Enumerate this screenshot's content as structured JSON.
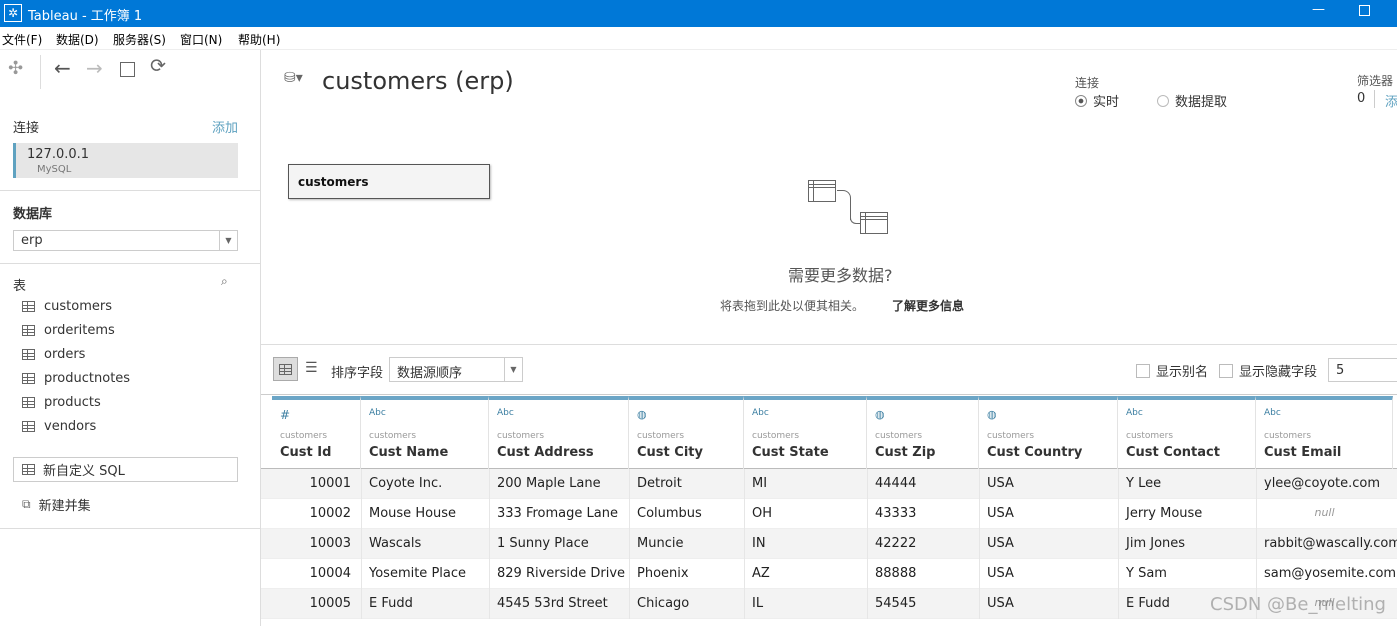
{
  "window": {
    "title": "Tableau - 工作簿 1"
  },
  "menu": [
    "文件(F)",
    "数据(D)",
    "服务器(S)",
    "窗口(N)",
    "帮助(H)"
  ],
  "sidebar": {
    "connections_label": "连接",
    "add_label": "添加",
    "connection": {
      "host": "127.0.0.1",
      "type": "MySQL"
    },
    "database_label": "数据库",
    "database_value": "erp",
    "tables_label": "表",
    "tables": [
      "customers",
      "orderitems",
      "orders",
      "productnotes",
      "products",
      "vendors"
    ],
    "custom_sql": "新自定义 SQL",
    "new_union": "新建并集"
  },
  "header": {
    "title": "customers (erp)",
    "connection_label": "连接",
    "live": "实时",
    "extract": "数据提取",
    "connection_mode": "live",
    "filters_label": "筛选器",
    "filters_count": "0",
    "filters_add": "添"
  },
  "canvas": {
    "table_chip": "customers",
    "need_more": "需要更多数据?",
    "hint": "将表拖到此处以便其相关。",
    "learn_more": "了解更多信息"
  },
  "grid_toolbar": {
    "sort_label": "排序字段",
    "sort_value": "数据源顺序",
    "show_alias": "显示别名",
    "show_hidden": "显示隐藏字段",
    "rows_value": "5"
  },
  "columns": [
    {
      "type": "#",
      "source": "customers",
      "name": "Cust Id"
    },
    {
      "type": "Abc",
      "source": "customers",
      "name": "Cust Name"
    },
    {
      "type": "Abc",
      "source": "customers",
      "name": "Cust Address"
    },
    {
      "type": "globe",
      "source": "customers",
      "name": "Cust City"
    },
    {
      "type": "Abc",
      "source": "customers",
      "name": "Cust State"
    },
    {
      "type": "globe",
      "source": "customers",
      "name": "Cust Zip"
    },
    {
      "type": "globe",
      "source": "customers",
      "name": "Cust Country"
    },
    {
      "type": "Abc",
      "source": "customers",
      "name": "Cust Contact"
    },
    {
      "type": "Abc",
      "source": "customers",
      "name": "Cust Email"
    }
  ],
  "rows": [
    [
      "10001",
      "Coyote Inc.",
      "200 Maple Lane",
      "Detroit",
      "MI",
      "44444",
      "USA",
      "Y Lee",
      "ylee@coyote.com"
    ],
    [
      "10002",
      "Mouse House",
      "333 Fromage Lane",
      "Columbus",
      "OH",
      "43333",
      "USA",
      "Jerry Mouse",
      "null"
    ],
    [
      "10003",
      "Wascals",
      "1 Sunny Place",
      "Muncie",
      "IN",
      "42222",
      "USA",
      "Jim Jones",
      "rabbit@wascally.com"
    ],
    [
      "10004",
      "Yosemite Place",
      "829 Riverside Drive",
      "Phoenix",
      "AZ",
      "88888",
      "USA",
      "Y Sam",
      "sam@yosemite.com"
    ],
    [
      "10005",
      "E Fudd",
      "4545 53rd Street",
      "Chicago",
      "IL",
      "54545",
      "USA",
      "E Fudd",
      "null"
    ]
  ],
  "watermark": "CSDN @Be_melting"
}
